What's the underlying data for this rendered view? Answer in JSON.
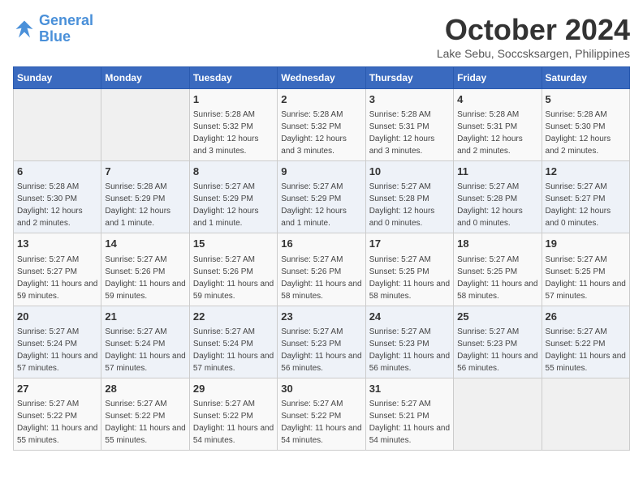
{
  "logo": {
    "line1": "General",
    "line2": "Blue"
  },
  "title": "October 2024",
  "subtitle": "Lake Sebu, Soccsksargen, Philippines",
  "days_of_week": [
    "Sunday",
    "Monday",
    "Tuesday",
    "Wednesday",
    "Thursday",
    "Friday",
    "Saturday"
  ],
  "weeks": [
    [
      {
        "day": "",
        "info": ""
      },
      {
        "day": "",
        "info": ""
      },
      {
        "day": "1",
        "info": "Sunrise: 5:28 AM\nSunset: 5:32 PM\nDaylight: 12 hours and 3 minutes."
      },
      {
        "day": "2",
        "info": "Sunrise: 5:28 AM\nSunset: 5:32 PM\nDaylight: 12 hours and 3 minutes."
      },
      {
        "day": "3",
        "info": "Sunrise: 5:28 AM\nSunset: 5:31 PM\nDaylight: 12 hours and 3 minutes."
      },
      {
        "day": "4",
        "info": "Sunrise: 5:28 AM\nSunset: 5:31 PM\nDaylight: 12 hours and 2 minutes."
      },
      {
        "day": "5",
        "info": "Sunrise: 5:28 AM\nSunset: 5:30 PM\nDaylight: 12 hours and 2 minutes."
      }
    ],
    [
      {
        "day": "6",
        "info": "Sunrise: 5:28 AM\nSunset: 5:30 PM\nDaylight: 12 hours and 2 minutes."
      },
      {
        "day": "7",
        "info": "Sunrise: 5:28 AM\nSunset: 5:29 PM\nDaylight: 12 hours and 1 minute."
      },
      {
        "day": "8",
        "info": "Sunrise: 5:27 AM\nSunset: 5:29 PM\nDaylight: 12 hours and 1 minute."
      },
      {
        "day": "9",
        "info": "Sunrise: 5:27 AM\nSunset: 5:29 PM\nDaylight: 12 hours and 1 minute."
      },
      {
        "day": "10",
        "info": "Sunrise: 5:27 AM\nSunset: 5:28 PM\nDaylight: 12 hours and 0 minutes."
      },
      {
        "day": "11",
        "info": "Sunrise: 5:27 AM\nSunset: 5:28 PM\nDaylight: 12 hours and 0 minutes."
      },
      {
        "day": "12",
        "info": "Sunrise: 5:27 AM\nSunset: 5:27 PM\nDaylight: 12 hours and 0 minutes."
      }
    ],
    [
      {
        "day": "13",
        "info": "Sunrise: 5:27 AM\nSunset: 5:27 PM\nDaylight: 11 hours and 59 minutes."
      },
      {
        "day": "14",
        "info": "Sunrise: 5:27 AM\nSunset: 5:26 PM\nDaylight: 11 hours and 59 minutes."
      },
      {
        "day": "15",
        "info": "Sunrise: 5:27 AM\nSunset: 5:26 PM\nDaylight: 11 hours and 59 minutes."
      },
      {
        "day": "16",
        "info": "Sunrise: 5:27 AM\nSunset: 5:26 PM\nDaylight: 11 hours and 58 minutes."
      },
      {
        "day": "17",
        "info": "Sunrise: 5:27 AM\nSunset: 5:25 PM\nDaylight: 11 hours and 58 minutes."
      },
      {
        "day": "18",
        "info": "Sunrise: 5:27 AM\nSunset: 5:25 PM\nDaylight: 11 hours and 58 minutes."
      },
      {
        "day": "19",
        "info": "Sunrise: 5:27 AM\nSunset: 5:25 PM\nDaylight: 11 hours and 57 minutes."
      }
    ],
    [
      {
        "day": "20",
        "info": "Sunrise: 5:27 AM\nSunset: 5:24 PM\nDaylight: 11 hours and 57 minutes."
      },
      {
        "day": "21",
        "info": "Sunrise: 5:27 AM\nSunset: 5:24 PM\nDaylight: 11 hours and 57 minutes."
      },
      {
        "day": "22",
        "info": "Sunrise: 5:27 AM\nSunset: 5:24 PM\nDaylight: 11 hours and 57 minutes."
      },
      {
        "day": "23",
        "info": "Sunrise: 5:27 AM\nSunset: 5:23 PM\nDaylight: 11 hours and 56 minutes."
      },
      {
        "day": "24",
        "info": "Sunrise: 5:27 AM\nSunset: 5:23 PM\nDaylight: 11 hours and 56 minutes."
      },
      {
        "day": "25",
        "info": "Sunrise: 5:27 AM\nSunset: 5:23 PM\nDaylight: 11 hours and 56 minutes."
      },
      {
        "day": "26",
        "info": "Sunrise: 5:27 AM\nSunset: 5:22 PM\nDaylight: 11 hours and 55 minutes."
      }
    ],
    [
      {
        "day": "27",
        "info": "Sunrise: 5:27 AM\nSunset: 5:22 PM\nDaylight: 11 hours and 55 minutes."
      },
      {
        "day": "28",
        "info": "Sunrise: 5:27 AM\nSunset: 5:22 PM\nDaylight: 11 hours and 55 minutes."
      },
      {
        "day": "29",
        "info": "Sunrise: 5:27 AM\nSunset: 5:22 PM\nDaylight: 11 hours and 54 minutes."
      },
      {
        "day": "30",
        "info": "Sunrise: 5:27 AM\nSunset: 5:22 PM\nDaylight: 11 hours and 54 minutes."
      },
      {
        "day": "31",
        "info": "Sunrise: 5:27 AM\nSunset: 5:21 PM\nDaylight: 11 hours and 54 minutes."
      },
      {
        "day": "",
        "info": ""
      },
      {
        "day": "",
        "info": ""
      }
    ]
  ]
}
